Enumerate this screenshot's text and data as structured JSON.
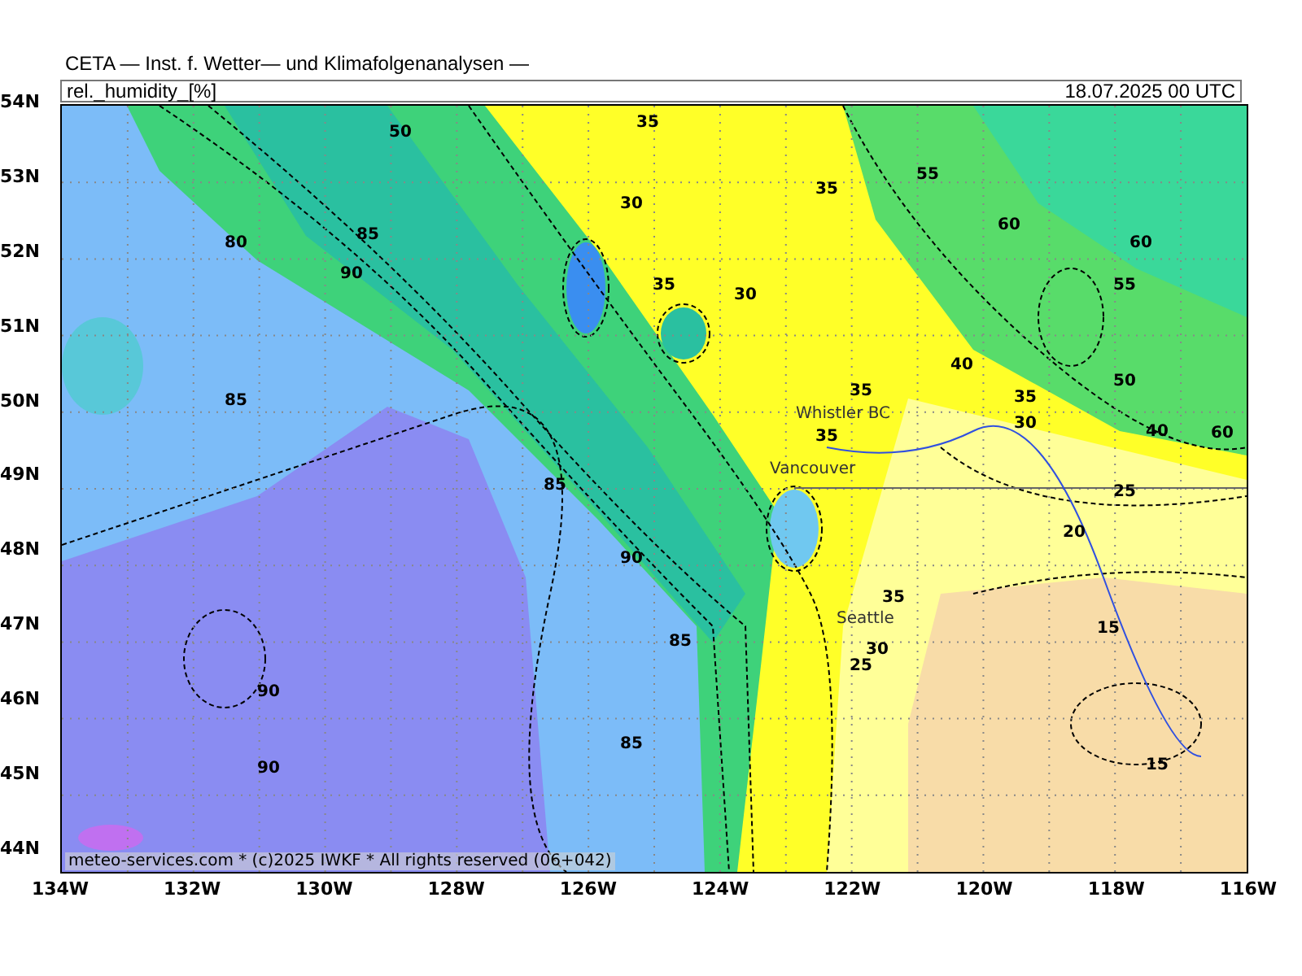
{
  "title": "CETA — Inst. f. Wetter— und Klimafolgenanalysen —",
  "header": {
    "variable": "rel._humidity_[%]",
    "valid_time": "18.07.2025 00 UTC"
  },
  "lat_ticks": [
    "54N",
    "53N",
    "52N",
    "51N",
    "50N",
    "49N",
    "48N",
    "47N",
    "46N",
    "45N",
    "44N"
  ],
  "lon_ticks": [
    "134W",
    "132W",
    "130W",
    "128W",
    "126W",
    "124W",
    "122W",
    "120W",
    "118W",
    "116W"
  ],
  "cities": [
    "Whistler BC",
    "Vancouver",
    "Seattle"
  ],
  "contour_labels": [
    "50",
    "35",
    "35",
    "30",
    "55",
    "60",
    "60",
    "55",
    "80",
    "85",
    "90",
    "35",
    "30",
    "40",
    "35",
    "30",
    "50",
    "40",
    "60",
    "35",
    "35",
    "85",
    "85",
    "25",
    "20",
    "90",
    "35",
    "85",
    "30",
    "25",
    "15",
    "90",
    "90",
    "85",
    "15"
  ],
  "credit": "meteo-services.com * (c)2025 IWKF * All rights reserved (06+042)"
}
